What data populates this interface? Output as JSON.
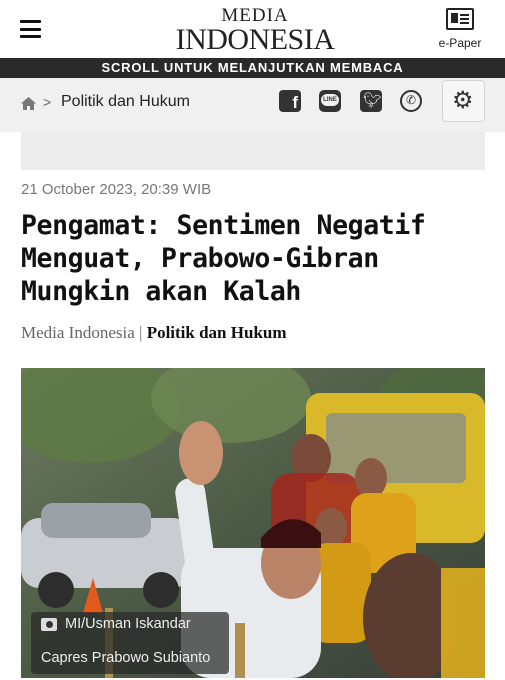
{
  "header": {
    "logo_line1": "MEDIA",
    "logo_line2": "INDONESIA",
    "epaper_label": "e-Paper",
    "menu_icon": "hamburger-icon",
    "epaper_icon": "newspaper-icon"
  },
  "scroll_banner": "SCROLL UNTUK MELANJUTKAN MEMBACA",
  "breadcrumb": {
    "home_icon": "home-icon",
    "separator": ">",
    "category": "Politik dan Hukum"
  },
  "share": {
    "facebook": "facebook-icon",
    "line": "line-icon",
    "line_text": "LINE",
    "twitter": "twitter-icon",
    "whatsapp": "whatsapp-icon",
    "settings": "gear-icon"
  },
  "article": {
    "date": "21 October 2023, 20:39 WIB",
    "title": "Pengamat: Sentimen Negatif Menguat, Prabowo-Gibran Mungkin akan Kalah",
    "source": "Media Indonesia",
    "byline_sep": " | ",
    "category": "Politik dan Hukum"
  },
  "photo": {
    "credit": "MI/Usman Iskandar",
    "caption": "Capres Prabowo Subianto"
  },
  "colors": {
    "banner_bg": "#2a2a2a",
    "crumb_bg": "#f0f0f0",
    "title": "#111111"
  }
}
